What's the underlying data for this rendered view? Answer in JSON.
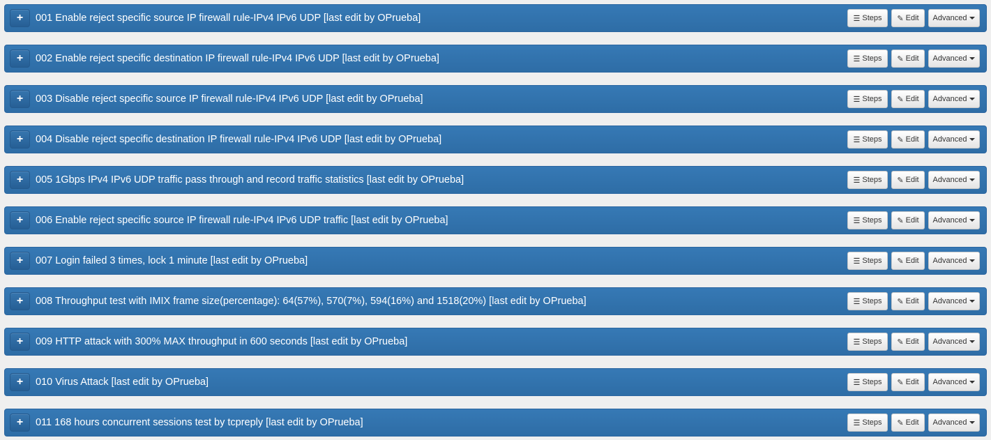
{
  "buttons": {
    "expand_label": "+",
    "steps_label": "Steps",
    "edit_label": "Edit",
    "advanced_label": "Advanced",
    "steps_icon": "list-icon",
    "edit_icon": "pencil-icon",
    "advanced_icon": "caret-down-icon"
  },
  "test_cases": [
    {
      "title": "001 Enable reject specific source IP firewall rule-IPv4 IPv6 UDP [last edit by OPrueba]"
    },
    {
      "title": "002 Enable reject specific destination IP firewall rule-IPv4 IPv6 UDP [last edit by OPrueba]"
    },
    {
      "title": "003 Disable reject specific source IP firewall rule-IPv4 IPv6 UDP [last edit by OPrueba]"
    },
    {
      "title": "004 Disable reject specific destination IP firewall rule-IPv4 IPv6 UDP [last edit by OPrueba]"
    },
    {
      "title": "005 1Gbps IPv4 IPv6 UDP traffic pass through and record traffic statistics [last edit by OPrueba]"
    },
    {
      "title": "006 Enable reject specific source IP firewall rule-IPv4 IPv6 UDP traffic [last edit by OPrueba]"
    },
    {
      "title": "007 Login failed 3 times, lock 1 minute [last edit by OPrueba]"
    },
    {
      "title": "008 Throughput test with IMIX frame size(percentage): 64(57%), 570(7%), 594(16%) and 1518(20%) [last edit by OPrueba]"
    },
    {
      "title": "009 HTTP attack with 300% MAX throughput in 600 seconds [last edit by OPrueba]"
    },
    {
      "title": "010 Virus Attack [last edit by OPrueba]"
    },
    {
      "title": "011 168 hours concurrent sessions test by tcpreply [last edit by OPrueba]"
    }
  ]
}
